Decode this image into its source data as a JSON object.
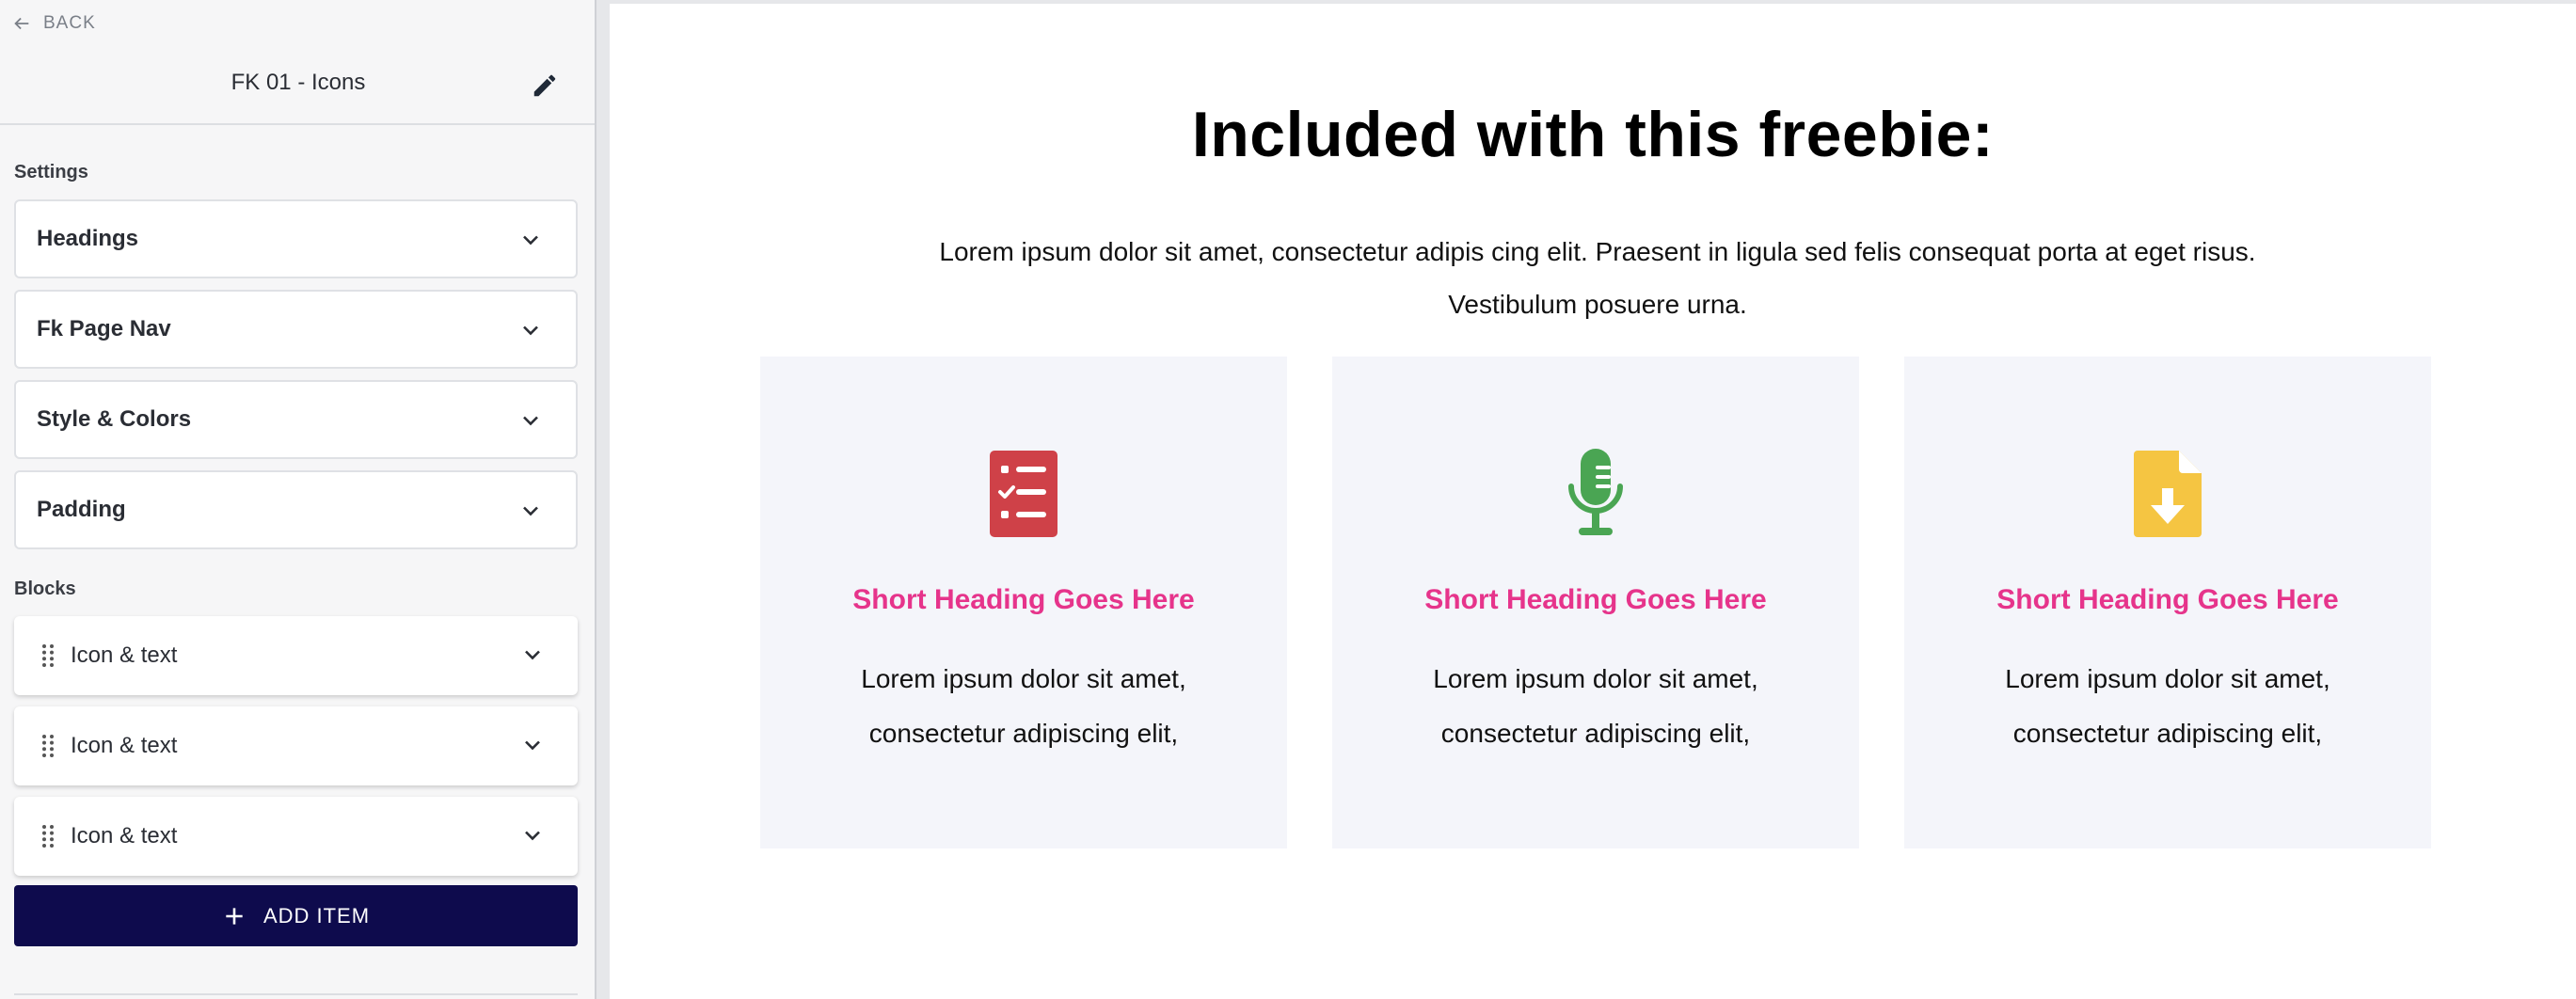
{
  "sidebar": {
    "back_label": "BACK",
    "block_title": "FK 01 - Icons",
    "settings_label": "Settings",
    "settings": [
      {
        "label": "Headings"
      },
      {
        "label": "Fk Page Nav"
      },
      {
        "label": "Style & Colors"
      },
      {
        "label": "Padding"
      }
    ],
    "blocks_label": "Blocks",
    "blocks": [
      {
        "label": "Icon & text"
      },
      {
        "label": "Icon & text"
      },
      {
        "label": "Icon & text"
      }
    ],
    "add_item_label": "ADD ITEM"
  },
  "preview": {
    "heading": "Included with this freebie:",
    "intro": "Lorem ipsum dolor sit amet, consectetur adipis cing elit. Praesent in ligula sed felis consequat porta at eget risus. Vestibulum posuere urna.",
    "cards": [
      {
        "icon": "checklist-icon",
        "icon_color": "#cf4148",
        "heading": "Short Heading Goes Here",
        "text": "Lorem ipsum dolor sit amet, consectetur adipiscing elit,"
      },
      {
        "icon": "microphone-icon",
        "icon_color": "#4aa553",
        "heading": "Short Heading Goes Here",
        "text": "Lorem ipsum dolor sit amet, consectetur adipiscing elit,"
      },
      {
        "icon": "file-download-icon",
        "icon_color": "#f5c542",
        "heading": "Short Heading Goes Here",
        "text": "Lorem ipsum dolor sit amet, consectetur adipiscing elit,"
      }
    ]
  },
  "colors": {
    "accent_heading": "#e6348b",
    "add_button_bg": "#0e0b4d",
    "card_bg": "#f4f5fa"
  }
}
